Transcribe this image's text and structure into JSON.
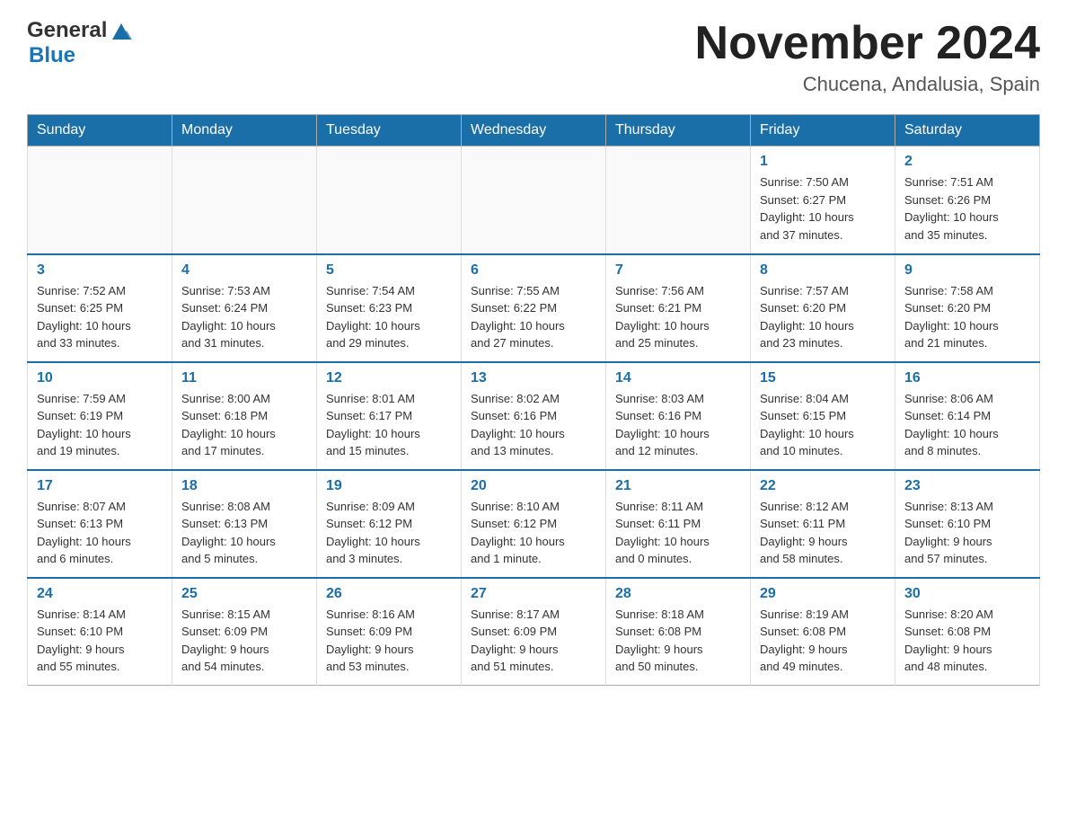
{
  "header": {
    "logo_general": "General",
    "logo_blue": "Blue",
    "month_title": "November 2024",
    "location": "Chucena, Andalusia, Spain"
  },
  "days_of_week": [
    "Sunday",
    "Monday",
    "Tuesday",
    "Wednesday",
    "Thursday",
    "Friday",
    "Saturday"
  ],
  "weeks": [
    [
      {
        "day": "",
        "info": ""
      },
      {
        "day": "",
        "info": ""
      },
      {
        "day": "",
        "info": ""
      },
      {
        "day": "",
        "info": ""
      },
      {
        "day": "",
        "info": ""
      },
      {
        "day": "1",
        "info": "Sunrise: 7:50 AM\nSunset: 6:27 PM\nDaylight: 10 hours\nand 37 minutes."
      },
      {
        "day": "2",
        "info": "Sunrise: 7:51 AM\nSunset: 6:26 PM\nDaylight: 10 hours\nand 35 minutes."
      }
    ],
    [
      {
        "day": "3",
        "info": "Sunrise: 7:52 AM\nSunset: 6:25 PM\nDaylight: 10 hours\nand 33 minutes."
      },
      {
        "day": "4",
        "info": "Sunrise: 7:53 AM\nSunset: 6:24 PM\nDaylight: 10 hours\nand 31 minutes."
      },
      {
        "day": "5",
        "info": "Sunrise: 7:54 AM\nSunset: 6:23 PM\nDaylight: 10 hours\nand 29 minutes."
      },
      {
        "day": "6",
        "info": "Sunrise: 7:55 AM\nSunset: 6:22 PM\nDaylight: 10 hours\nand 27 minutes."
      },
      {
        "day": "7",
        "info": "Sunrise: 7:56 AM\nSunset: 6:21 PM\nDaylight: 10 hours\nand 25 minutes."
      },
      {
        "day": "8",
        "info": "Sunrise: 7:57 AM\nSunset: 6:20 PM\nDaylight: 10 hours\nand 23 minutes."
      },
      {
        "day": "9",
        "info": "Sunrise: 7:58 AM\nSunset: 6:20 PM\nDaylight: 10 hours\nand 21 minutes."
      }
    ],
    [
      {
        "day": "10",
        "info": "Sunrise: 7:59 AM\nSunset: 6:19 PM\nDaylight: 10 hours\nand 19 minutes."
      },
      {
        "day": "11",
        "info": "Sunrise: 8:00 AM\nSunset: 6:18 PM\nDaylight: 10 hours\nand 17 minutes."
      },
      {
        "day": "12",
        "info": "Sunrise: 8:01 AM\nSunset: 6:17 PM\nDaylight: 10 hours\nand 15 minutes."
      },
      {
        "day": "13",
        "info": "Sunrise: 8:02 AM\nSunset: 6:16 PM\nDaylight: 10 hours\nand 13 minutes."
      },
      {
        "day": "14",
        "info": "Sunrise: 8:03 AM\nSunset: 6:16 PM\nDaylight: 10 hours\nand 12 minutes."
      },
      {
        "day": "15",
        "info": "Sunrise: 8:04 AM\nSunset: 6:15 PM\nDaylight: 10 hours\nand 10 minutes."
      },
      {
        "day": "16",
        "info": "Sunrise: 8:06 AM\nSunset: 6:14 PM\nDaylight: 10 hours\nand 8 minutes."
      }
    ],
    [
      {
        "day": "17",
        "info": "Sunrise: 8:07 AM\nSunset: 6:13 PM\nDaylight: 10 hours\nand 6 minutes."
      },
      {
        "day": "18",
        "info": "Sunrise: 8:08 AM\nSunset: 6:13 PM\nDaylight: 10 hours\nand 5 minutes."
      },
      {
        "day": "19",
        "info": "Sunrise: 8:09 AM\nSunset: 6:12 PM\nDaylight: 10 hours\nand 3 minutes."
      },
      {
        "day": "20",
        "info": "Sunrise: 8:10 AM\nSunset: 6:12 PM\nDaylight: 10 hours\nand 1 minute."
      },
      {
        "day": "21",
        "info": "Sunrise: 8:11 AM\nSunset: 6:11 PM\nDaylight: 10 hours\nand 0 minutes."
      },
      {
        "day": "22",
        "info": "Sunrise: 8:12 AM\nSunset: 6:11 PM\nDaylight: 9 hours\nand 58 minutes."
      },
      {
        "day": "23",
        "info": "Sunrise: 8:13 AM\nSunset: 6:10 PM\nDaylight: 9 hours\nand 57 minutes."
      }
    ],
    [
      {
        "day": "24",
        "info": "Sunrise: 8:14 AM\nSunset: 6:10 PM\nDaylight: 9 hours\nand 55 minutes."
      },
      {
        "day": "25",
        "info": "Sunrise: 8:15 AM\nSunset: 6:09 PM\nDaylight: 9 hours\nand 54 minutes."
      },
      {
        "day": "26",
        "info": "Sunrise: 8:16 AM\nSunset: 6:09 PM\nDaylight: 9 hours\nand 53 minutes."
      },
      {
        "day": "27",
        "info": "Sunrise: 8:17 AM\nSunset: 6:09 PM\nDaylight: 9 hours\nand 51 minutes."
      },
      {
        "day": "28",
        "info": "Sunrise: 8:18 AM\nSunset: 6:08 PM\nDaylight: 9 hours\nand 50 minutes."
      },
      {
        "day": "29",
        "info": "Sunrise: 8:19 AM\nSunset: 6:08 PM\nDaylight: 9 hours\nand 49 minutes."
      },
      {
        "day": "30",
        "info": "Sunrise: 8:20 AM\nSunset: 6:08 PM\nDaylight: 9 hours\nand 48 minutes."
      }
    ]
  ]
}
